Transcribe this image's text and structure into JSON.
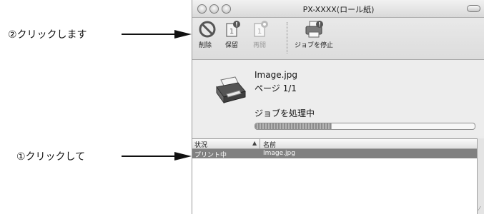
{
  "annotations": {
    "step2": "②クリックします",
    "step1": "①クリックして"
  },
  "window": {
    "title": "PX-XXXX(ロール紙)"
  },
  "toolbar": {
    "delete_label": "削除",
    "hold_label": "保留",
    "resume_label": "再開",
    "stop_jobs_label": "ジョブを停止"
  },
  "job": {
    "file_name": "Image.jpg",
    "page_info": "ページ 1/1",
    "status_text": "ジョブを処理中",
    "progress_percent": 35
  },
  "queue": {
    "columns": [
      "状況",
      "名前"
    ],
    "sort_indicator": "▲",
    "rows": [
      {
        "status": "プリント中",
        "name": "Image.jpg",
        "selected": true
      }
    ]
  },
  "icons": {
    "delete": "no-entry-icon",
    "hold": "document-badge-icon",
    "resume": "document-badge-icon",
    "stop_jobs": "printer-badge-icon",
    "printer": "printer-icon"
  }
}
